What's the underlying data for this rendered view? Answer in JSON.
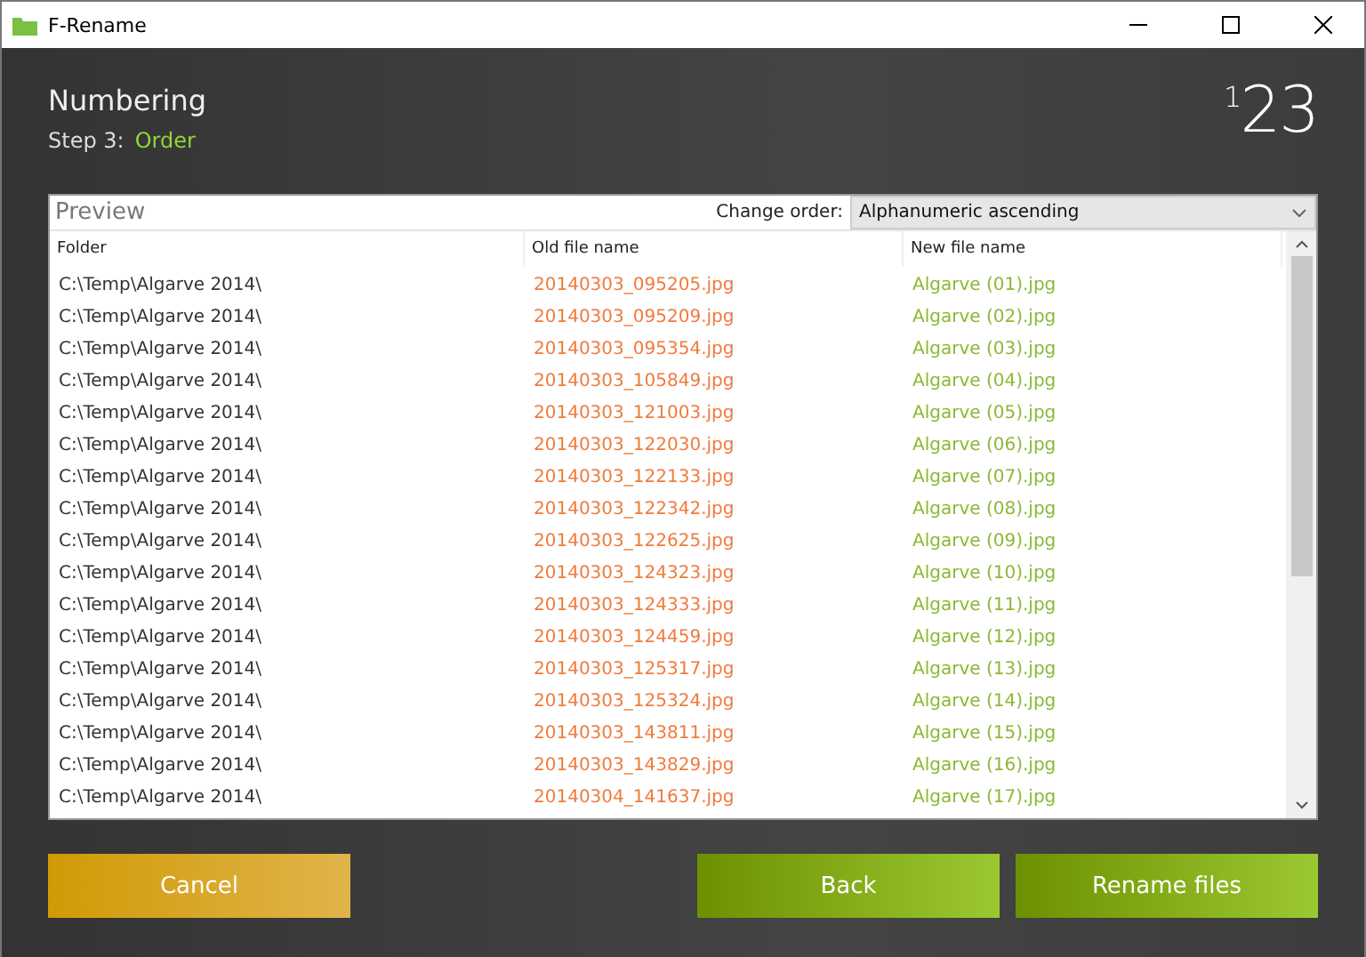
{
  "window": {
    "title": "F-Rename"
  },
  "header": {
    "title": "Numbering",
    "step_label": "Step 3:",
    "step_name": "Order",
    "logo": "$^{1}$23"
  },
  "preview": {
    "title": "Preview",
    "order_label": "Change order:",
    "order_value": "Alphanumeric ascending"
  },
  "table": {
    "columns": [
      "Folder",
      "Old file name",
      "New file name"
    ],
    "rows": [
      [
        "C:\\Temp\\Algarve 2014\\",
        "20140303_095205.jpg",
        "Algarve (01).jpg"
      ],
      [
        "C:\\Temp\\Algarve 2014\\",
        "20140303_095209.jpg",
        "Algarve (02).jpg"
      ],
      [
        "C:\\Temp\\Algarve 2014\\",
        "20140303_095354.jpg",
        "Algarve (03).jpg"
      ],
      [
        "C:\\Temp\\Algarve 2014\\",
        "20140303_105849.jpg",
        "Algarve (04).jpg"
      ],
      [
        "C:\\Temp\\Algarve 2014\\",
        "20140303_121003.jpg",
        "Algarve (05).jpg"
      ],
      [
        "C:\\Temp\\Algarve 2014\\",
        "20140303_122030.jpg",
        "Algarve (06).jpg"
      ],
      [
        "C:\\Temp\\Algarve 2014\\",
        "20140303_122133.jpg",
        "Algarve (07).jpg"
      ],
      [
        "C:\\Temp\\Algarve 2014\\",
        "20140303_122342.jpg",
        "Algarve (08).jpg"
      ],
      [
        "C:\\Temp\\Algarve 2014\\",
        "20140303_122625.jpg",
        "Algarve (09).jpg"
      ],
      [
        "C:\\Temp\\Algarve 2014\\",
        "20140303_124323.jpg",
        "Algarve (10).jpg"
      ],
      [
        "C:\\Temp\\Algarve 2014\\",
        "20140303_124333.jpg",
        "Algarve (11).jpg"
      ],
      [
        "C:\\Temp\\Algarve 2014\\",
        "20140303_124459.jpg",
        "Algarve (12).jpg"
      ],
      [
        "C:\\Temp\\Algarve 2014\\",
        "20140303_125317.jpg",
        "Algarve (13).jpg"
      ],
      [
        "C:\\Temp\\Algarve 2014\\",
        "20140303_125324.jpg",
        "Algarve (14).jpg"
      ],
      [
        "C:\\Temp\\Algarve 2014\\",
        "20140303_143811.jpg",
        "Algarve (15).jpg"
      ],
      [
        "C:\\Temp\\Algarve 2014\\",
        "20140303_143829.jpg",
        "Algarve (16).jpg"
      ],
      [
        "C:\\Temp\\Algarve 2014\\",
        "20140304_141637.jpg",
        "Algarve (17).jpg"
      ]
    ]
  },
  "buttons": {
    "cancel": "Cancel",
    "back": "Back",
    "rename": "Rename files"
  }
}
